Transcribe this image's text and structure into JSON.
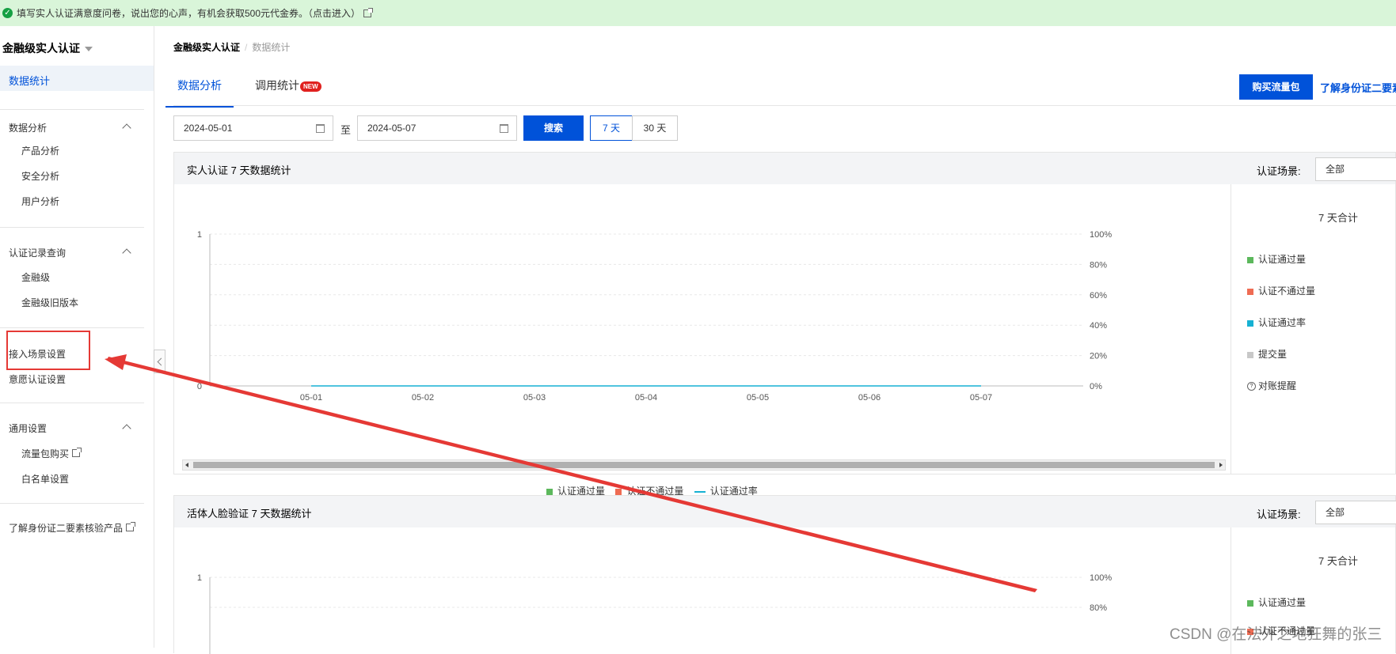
{
  "banner": {
    "text": "填写实人认证满意度问卷，说出您的心声，有机会获取500元代金券。（点击进入）",
    "icon": "check-circle-icon"
  },
  "sidebar": {
    "product_title": "金融级实人认证",
    "active_item": "数据统计",
    "groups": [
      {
        "title": "数据分析",
        "items": [
          "产品分析",
          "安全分析",
          "用户分析"
        ]
      },
      {
        "title": "认证记录查询",
        "items": [
          "金融级",
          "金融级旧版本"
        ]
      },
      {
        "title": "",
        "items": [
          "接入场景设置",
          "意愿认证设置"
        ]
      },
      {
        "title": "通用设置",
        "items": [
          "流量包购买",
          "白名单设置"
        ]
      }
    ],
    "bottom_link": "了解身份证二要素核验产品"
  },
  "breadcrumb": {
    "root": "金融级实人认证",
    "current": "数据统计"
  },
  "tabs": [
    {
      "label": "数据分析",
      "active": true
    },
    {
      "label": "调用统计",
      "badge": "NEW",
      "active": false
    }
  ],
  "actions": {
    "buy_label": "购买流量包",
    "learn_label": "了解身份证二要素"
  },
  "filters": {
    "start_date": "2024-05-01",
    "to_label": "至",
    "end_date": "2024-05-07",
    "search_label": "搜索",
    "range_options": [
      "7 天",
      "30 天"
    ],
    "selected_range": "7 天"
  },
  "panels": [
    {
      "title": "实人认证 7 天数据统计",
      "scene_label": "认证场景:",
      "scene_value": "全部",
      "stats_title": "7 天合计",
      "legend": [
        "认证通过量",
        "认证不通过量",
        "认证通过率",
        "提交量"
      ],
      "reconcile_label": "对账提醒"
    },
    {
      "title": "活体人脸验证 7 天数据统计",
      "scene_label": "认证场景:",
      "scene_value": "全部",
      "stats_title": "7 天合计",
      "legend": [
        "认证通过量",
        "认证不通过量"
      ]
    }
  ],
  "colors": {
    "pass": "#5cb85c",
    "fail": "#ef6c53",
    "rate": "#16b1d3",
    "submit": "#c8c8c8",
    "primary": "#0052d9",
    "annotation": "#e53935"
  },
  "chart_data": [
    {
      "type": "line",
      "categories": [
        "05-01",
        "05-02",
        "05-03",
        "05-04",
        "05-05",
        "05-06",
        "05-07"
      ],
      "y_left": {
        "ticks": [
          "0",
          "1"
        ],
        "range": [
          0,
          1
        ]
      },
      "y_right": {
        "ticks": [
          "0%",
          "20%",
          "40%",
          "60%",
          "80%",
          "100%"
        ],
        "range": [
          0,
          100
        ]
      },
      "series": [
        {
          "name": "认证通过量",
          "kind": "bar",
          "values": [
            0,
            0,
            0,
            0,
            0,
            0,
            0
          ]
        },
        {
          "name": "认证不通过量",
          "kind": "bar",
          "values": [
            0,
            0,
            0,
            0,
            0,
            0,
            0
          ]
        },
        {
          "name": "认证通过率",
          "kind": "line",
          "values": [
            0,
            0,
            0,
            0,
            0,
            0,
            0
          ]
        }
      ],
      "legend_position": "bottom"
    },
    {
      "type": "line",
      "y_left": {
        "ticks": [
          "1"
        ]
      },
      "y_right": {
        "ticks": [
          "80%",
          "100%"
        ]
      }
    }
  ],
  "watermark": "CSDN @在法外之地狂舞的张三"
}
